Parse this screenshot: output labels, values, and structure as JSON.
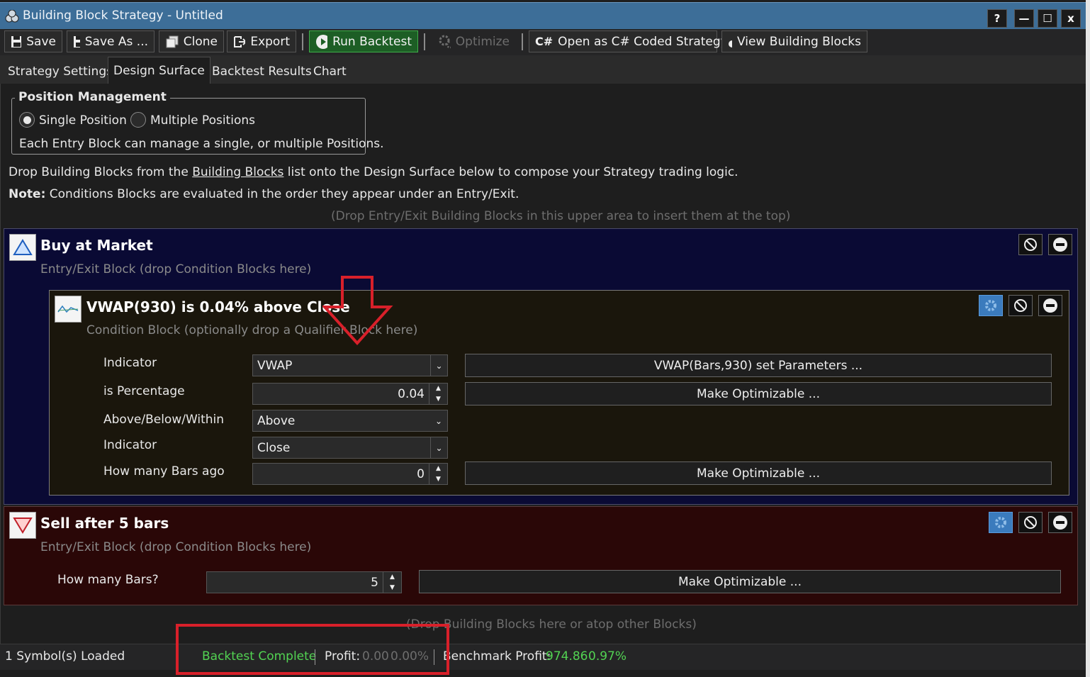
{
  "window": {
    "title": "Building Block Strategy - Untitled",
    "help": "?",
    "minimize": "—",
    "maximize": "☐",
    "close": "x"
  },
  "toolbar": {
    "save": "Save",
    "save_as": "Save As ...",
    "clone": "Clone",
    "export": "Export",
    "run": "Run Backtest",
    "optimize": "Optimize",
    "cs_prefix": "C#",
    "open_cs": "Open as C# Coded Strategy",
    "view_blocks": "View Building Blocks"
  },
  "tabs": [
    "Strategy Settings",
    "Design Surface",
    "Backtest Results",
    "Chart"
  ],
  "position": {
    "legend": "Position Management",
    "single": "Single Position",
    "multiple": "Multiple Positions",
    "desc": "Each Entry Block can manage a single, or multiple Positions."
  },
  "info": {
    "line1_a": "Drop Building Blocks from the ",
    "line1_link": "Building Blocks",
    "line1_b": " list onto the Design Surface below to compose your Strategy trading logic.",
    "note_label": "Note:",
    "note_text": " Conditions Blocks are evaluated in the order they appear under an Entry/Exit.",
    "drop_top": "(Drop Entry/Exit Building Blocks in this upper area to insert them at the top)",
    "drop_bottom": "(Drop Building Blocks here or atop other Blocks)"
  },
  "buy": {
    "title": "Buy at Market",
    "sub": "Entry/Exit Block (drop Condition Blocks here)"
  },
  "condition": {
    "title": "VWAP(930) is 0.04% above Close",
    "sub": "Condition Block (optionally drop a Qualifier Block here)",
    "rows": {
      "indicator_label": "Indicator",
      "indicator_value": "VWAP",
      "set_params": "VWAP(Bars,930) set Parameters ...",
      "pct_label": "is Percentage",
      "pct_value": "0.04",
      "make_opt": "Make Optimizable ...",
      "abw_label": "Above/Below/Within",
      "abw_value": "Above",
      "indicator2_label": "Indicator",
      "indicator2_value": "Close",
      "bars_ago_label": "How many Bars ago",
      "bars_ago_value": "0"
    }
  },
  "sell": {
    "title": "Sell after 5 bars",
    "sub": "Entry/Exit Block (drop Condition Blocks here)",
    "bars_label": "How many Bars?",
    "bars_value": "5",
    "make_opt": "Make Optimizable ..."
  },
  "status": {
    "symbols": "1 Symbol(s) Loaded",
    "complete": "Backtest Complete",
    "profit_label": "Profit:",
    "profit_value": "0.00",
    "profit_pct": "0.00%",
    "bench_label": "Benchmark Profit:",
    "bench_value": "974.86",
    "bench_pct": "0.97%"
  },
  "colors": {
    "annotation": "#d8202a",
    "accent_green": "#52d352",
    "titlebar": "#3d6e98"
  }
}
